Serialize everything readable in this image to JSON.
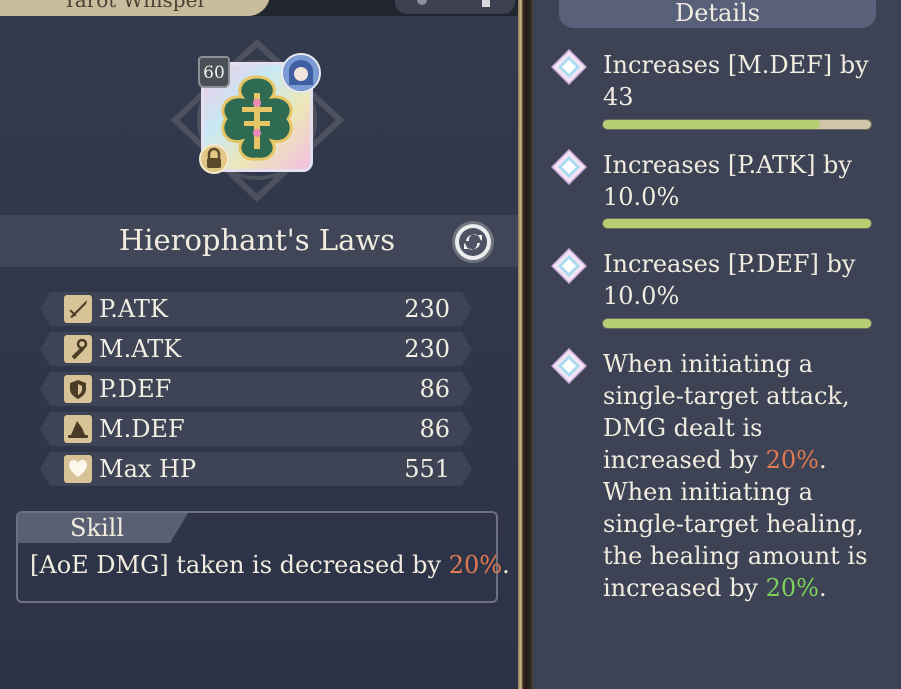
{
  "header": {
    "title": "Tarot Whisper"
  },
  "card": {
    "level": "60"
  },
  "item": {
    "name": "Hierophant's Laws"
  },
  "stats": [
    {
      "name": "P.ATK",
      "value": "230",
      "icon": "sword-icon"
    },
    {
      "name": "M.ATK",
      "value": "230",
      "icon": "wand-icon"
    },
    {
      "name": "P.DEF",
      "value": "86",
      "icon": "shield-icon"
    },
    {
      "name": "M.DEF",
      "value": "86",
      "icon": "hat-icon"
    },
    {
      "name": "Max HP",
      "value": "551",
      "icon": "heart-icon"
    }
  ],
  "skill": {
    "label": "Skill",
    "text_before": "[AoE DMG] taken is decreased by ",
    "highlight": "20%",
    "text_after": "."
  },
  "details": {
    "header": "Details",
    "items": [
      {
        "line1": "Increases [M.DEF] by",
        "line2": "43",
        "progress": 0.81
      },
      {
        "line1": "Increases [P.ATK] by",
        "line2": "10.0%",
        "progress": 1.0
      },
      {
        "line1": "Increases [P.DEF] by",
        "line2": "10.0%",
        "progress": 1.0
      }
    ],
    "effect": {
      "part1": "When initiating a single-target attack, DMG dealt is increased by ",
      "value1": "20%",
      "part2": ". When initiating a single-target healing, the healing amount is increased by ",
      "value2": "20%",
      "part3": "."
    }
  },
  "colors": {
    "highlight_red": "#e07a52",
    "highlight_green": "#7cd25a",
    "bar_fill": "#b7cf72"
  }
}
